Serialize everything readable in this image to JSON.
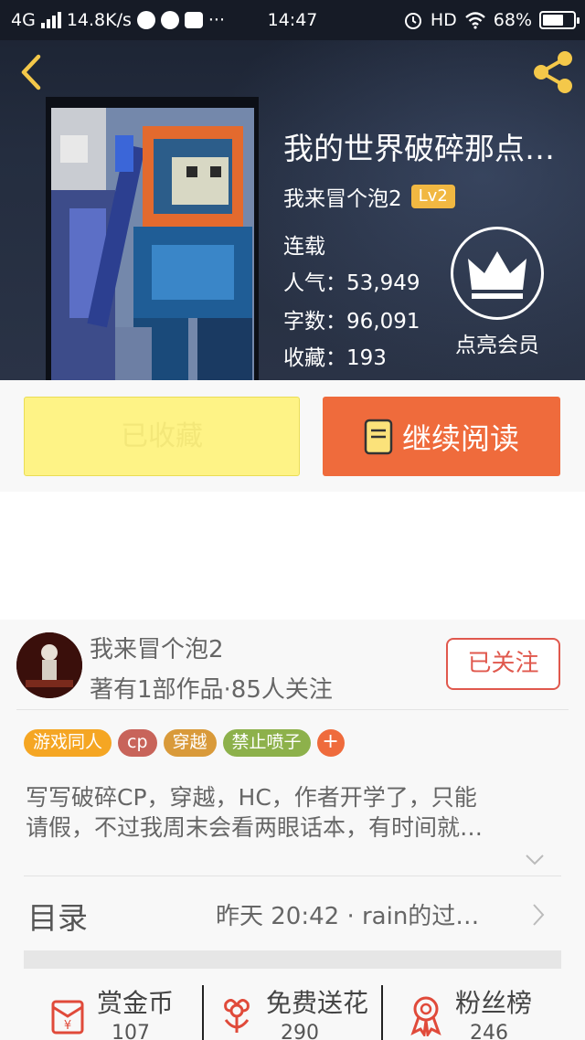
{
  "status_bar": {
    "network": "4G",
    "speed": "14.8K/s",
    "time": "14:47",
    "hd": "HD",
    "battery": "68%",
    "battery_level": 0.68
  },
  "book": {
    "title": "我的世界破碎那点…",
    "author": "我来冒个泡2",
    "level": "Lv2",
    "status": "连载",
    "popularity_label": "人气：",
    "popularity": "53,949",
    "words_label": "字数：",
    "words": "96,091",
    "favorites_label": "收藏：",
    "favorites": "193"
  },
  "vip": {
    "label": "点亮会员"
  },
  "actions": {
    "collected_label": "已收藏",
    "read_label": "继续阅读"
  },
  "author_info": {
    "name": "我来冒个泡2",
    "stats": "著有1部作品·85人关注",
    "follow_label": "已关注"
  },
  "tags": [
    {
      "label": "游戏同人",
      "color": "#f5a623"
    },
    {
      "label": "cp",
      "color": "#c8645a"
    },
    {
      "label": "穿越",
      "color": "#d99a3a"
    },
    {
      "label": "禁止喷子",
      "color": "#8db14b"
    }
  ],
  "tag_add": "+",
  "description": [
    "写写破碎CP，穿越，HC，作者开学了，只能",
    "请假，不过我周末会看两眼话本，有时间就…"
  ],
  "toc": {
    "title": "目录",
    "latest": "昨天 20:42 · rain的过…"
  },
  "stats": [
    {
      "label": "赏金币",
      "value": "107",
      "icon": "red-envelope-icon"
    },
    {
      "label": "免费送花",
      "value": "290",
      "icon": "flower-icon"
    },
    {
      "label": "粉丝榜",
      "value": "246",
      "icon": "medal-icon"
    }
  ],
  "colors": {
    "accent": "#ef6b3c",
    "collected": "#fef386",
    "follow": "#e0584d",
    "level_badge": "#f1b842",
    "back_arrow": "#f4c84a"
  }
}
